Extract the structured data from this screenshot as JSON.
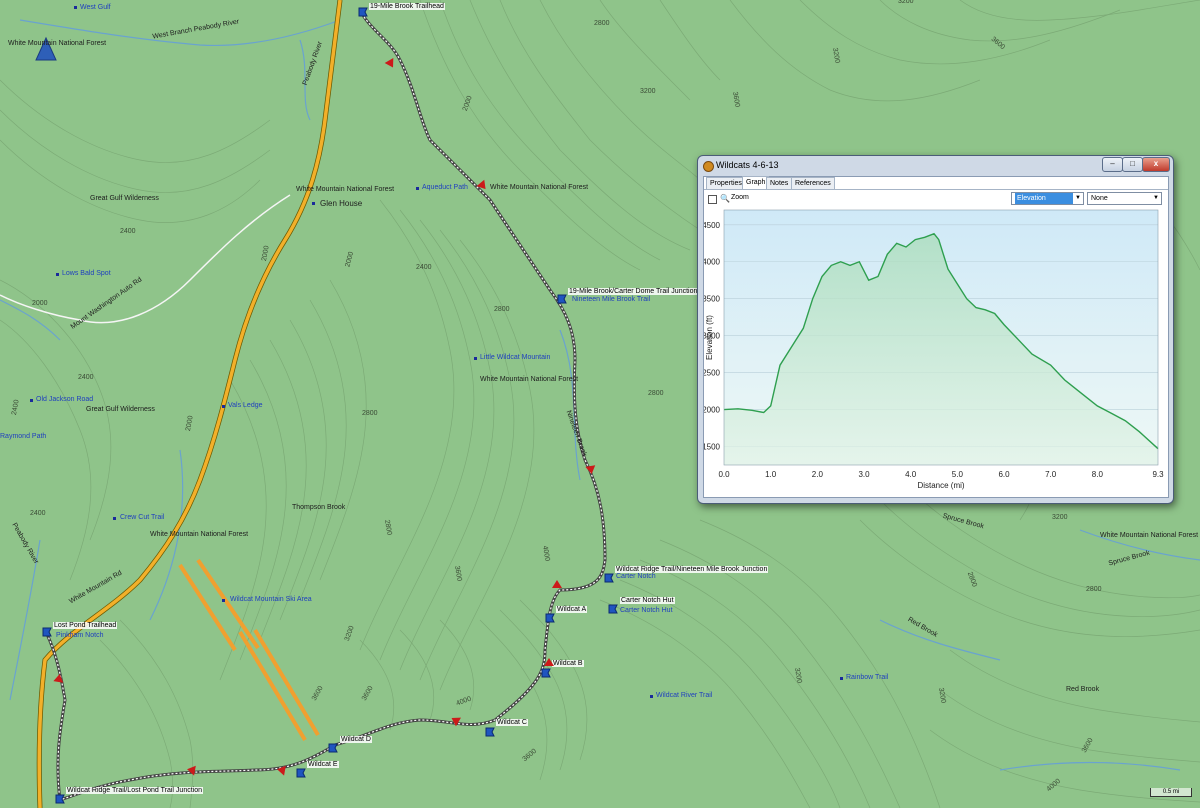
{
  "window": {
    "title": "Wildcats 4-6-13",
    "buttons": {
      "minimize": "–",
      "maximize": "□",
      "close": "x"
    },
    "tabs": [
      "Properties",
      "Graph",
      "Notes",
      "References"
    ],
    "active_tab": "Graph",
    "zoom_label": "Zoom",
    "dropdown1": "Elevation",
    "dropdown2": "None",
    "accent": "#2e9f4f"
  },
  "chart_data": {
    "type": "area",
    "xlabel": "Distance  (mi)",
    "ylabel": "Elevation (ft)",
    "xlim": [
      0,
      9.3
    ],
    "ylim": [
      1250,
      4700
    ],
    "x_ticks": [
      "0.0",
      "1.0",
      "2.0",
      "3.0",
      "4.0",
      "5.0",
      "6.0",
      "7.0",
      "8.0",
      "9.3"
    ],
    "x_tick_values": [
      0,
      1,
      2,
      3,
      4,
      5,
      6,
      7,
      8,
      9.3
    ],
    "y_ticks": [
      1500,
      2000,
      2500,
      3000,
      3500,
      4000,
      4500
    ],
    "grid": true,
    "series": [
      {
        "name": "Elevation",
        "x": [
          0,
          0.3,
          0.6,
          0.85,
          1.0,
          1.2,
          1.5,
          1.7,
          1.9,
          2.1,
          2.3,
          2.5,
          2.7,
          2.9,
          3.1,
          3.3,
          3.5,
          3.7,
          3.9,
          4.1,
          4.3,
          4.5,
          4.6,
          4.8,
          5.0,
          5.2,
          5.4,
          5.6,
          5.8,
          6.0,
          6.3,
          6.6,
          7.0,
          7.3,
          7.7,
          8.0,
          8.3,
          8.6,
          8.9,
          9.3
        ],
        "y": [
          2000,
          2010,
          1990,
          1960,
          2050,
          2600,
          2900,
          3100,
          3500,
          3800,
          3950,
          4000,
          3950,
          4000,
          3750,
          3800,
          4100,
          4250,
          4200,
          4300,
          4330,
          4380,
          4300,
          3900,
          3700,
          3500,
          3380,
          3350,
          3300,
          3150,
          2950,
          2750,
          2600,
          2400,
          2200,
          2050,
          1950,
          1850,
          1700,
          1470
        ]
      }
    ]
  },
  "map": {
    "labels": [
      {
        "t": "West Gulf",
        "k": "blue"
      },
      {
        "t": "White Mountain National Forest",
        "k": "plain"
      },
      {
        "t": "West Branch Peabody River",
        "k": "plain"
      },
      {
        "t": "Peabody River",
        "k": "plain"
      },
      {
        "t": "White Mountain National Forest",
        "k": "plain"
      },
      {
        "t": "Glen House",
        "k": "plain"
      },
      {
        "t": "Great Gulf Wilderness",
        "k": "plain"
      },
      {
        "t": "Lows Bald Spot",
        "k": "blue"
      },
      {
        "t": "Mount Washington Auto Rd",
        "k": "plain"
      },
      {
        "t": "Old Jackson Road",
        "k": "blue"
      },
      {
        "t": "Great Gulf Wilderness",
        "k": "plain"
      },
      {
        "t": "Vals Ledge",
        "k": "blue"
      },
      {
        "t": "Aqueduct Path",
        "k": "blue"
      },
      {
        "t": "White Mountain National Forest",
        "k": "plain"
      },
      {
        "t": "Nineteen Mile Brook Trail",
        "k": "blue"
      },
      {
        "t": "Little Wildcat Mountain",
        "k": "blue"
      },
      {
        "t": "White Mountain National Forest",
        "k": "plain"
      },
      {
        "t": "Nineteen Brook",
        "k": "plain"
      },
      {
        "t": "Thompson Brook",
        "k": "plain"
      },
      {
        "t": "Crew Cut Trail",
        "k": "blue"
      },
      {
        "t": "White Mountain National Forest",
        "k": "plain"
      },
      {
        "t": "Wildcat Mountain Ski Area",
        "k": "blue"
      },
      {
        "t": "Peabody River",
        "k": "plain"
      },
      {
        "t": "White Mountain Rd",
        "k": "plain"
      },
      {
        "t": "Carter Notch",
        "k": "blue"
      },
      {
        "t": "Carter Notch Hut",
        "k": "blue"
      },
      {
        "t": "Wildcat River Trail",
        "k": "blue"
      },
      {
        "t": "Rainbow Trail",
        "k": "blue"
      },
      {
        "t": "Red Brook",
        "k": "plain"
      },
      {
        "t": "Red Brook",
        "k": "plain"
      },
      {
        "t": "Spruce Brook",
        "k": "plain"
      },
      {
        "t": "Spruce Brook",
        "k": "plain"
      },
      {
        "t": "White Mountain National Forest",
        "k": "plain"
      },
      {
        "t": "Raymond Path",
        "k": "blue"
      },
      {
        "t": "Pinkham Notch",
        "k": "blue"
      }
    ],
    "waypoints": [
      "19-Mile Brook Trailhead",
      "19-Mile Brook/Carter Dome Trail Junction",
      "Wildcat Ridge Trail/Nineteen Mile Brook Junction",
      "Carter Notch Hut",
      "Wildcat A",
      "Wildcat B",
      "Wildcat C",
      "Wildcat D",
      "Wildcat E",
      "Lost Pond Trailhead",
      "Wildcat Ridge Trail/Lost Pond Trail Junction"
    ],
    "contours": [
      "3200",
      "3600",
      "3200",
      "2800",
      "3600",
      "2400",
      "2000",
      "2800",
      "2800",
      "2000",
      "2400",
      "2800",
      "2000",
      "2400",
      "2400",
      "2000",
      "2400",
      "2800",
      "2000",
      "3200",
      "3600",
      "4000",
      "3600",
      "3200",
      "3600",
      "4000",
      "3600",
      "3200",
      "2800",
      "2800",
      "3200",
      "3600",
      "4000",
      "3200"
    ],
    "scale": "0.5 mi"
  }
}
